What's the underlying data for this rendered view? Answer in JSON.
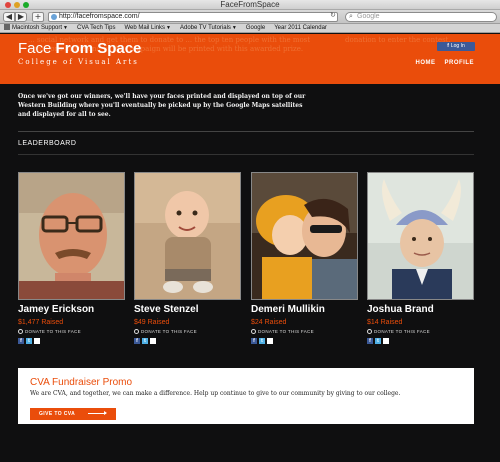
{
  "window": {
    "title": "FaceFromSpace"
  },
  "toolbar": {
    "back_icon": "back-arrow-icon",
    "forward_icon": "forward-arrow-icon",
    "add_icon": "plus-icon",
    "url": "http://facefromspace.com/",
    "search_placeholder": "Google"
  },
  "bookmarks": [
    {
      "label": "Macintosh Support",
      "has_dropdown": true
    },
    {
      "label": "CVA Tech Tips",
      "has_dropdown": false
    },
    {
      "label": "Web Mail Links",
      "has_dropdown": true
    },
    {
      "label": "Adobe TV Tutorials",
      "has_dropdown": true
    },
    {
      "label": "Google",
      "has_dropdown": false
    },
    {
      "label": "Year 2011 Calendar",
      "has_dropdown": false
    }
  ],
  "header": {
    "logo_face": "Face",
    "logo_space": "From Space",
    "logo_sub": "College of Visual Arts",
    "fb_login": "Log In",
    "ghost_left": "... social network and get them to donate to ... the top ten people with the most donations at the end of the campaign will be printed with this awarded prize.",
    "ghost_right": "donation to enter the contest.",
    "nav": [
      {
        "label": "HOME"
      },
      {
        "label": "PROFILE"
      }
    ]
  },
  "intro": "Once we've got our winners, we'll have your faces printed and displayed on top of our Western Building where you'll eventually be picked up by the Google Maps satellites and displayed for all to see.",
  "leaderboard": {
    "title": "LEADERBOARD",
    "donate_label": "DONATE TO THIS FACE",
    "people": [
      {
        "name": "Jamey Erickson",
        "raised": "$1,477 Raised"
      },
      {
        "name": "Steve Stenzel",
        "raised": "$49 Raised"
      },
      {
        "name": "Demeri Mullikin",
        "raised": "$24 Raised"
      },
      {
        "name": "Joshua Brand",
        "raised": "$14 Raised"
      }
    ]
  },
  "promo": {
    "title": "CVA Fundraiser Promo",
    "text": "We are CVA, and together, we can make a difference. Help up continue to give to our community by giving to our college.",
    "button": "GIVE TO CVA"
  },
  "colors": {
    "accent": "#ea4d0b",
    "background": "#0f0f10",
    "facebook": "#3b5998",
    "twitter": "#4fb0e5"
  }
}
